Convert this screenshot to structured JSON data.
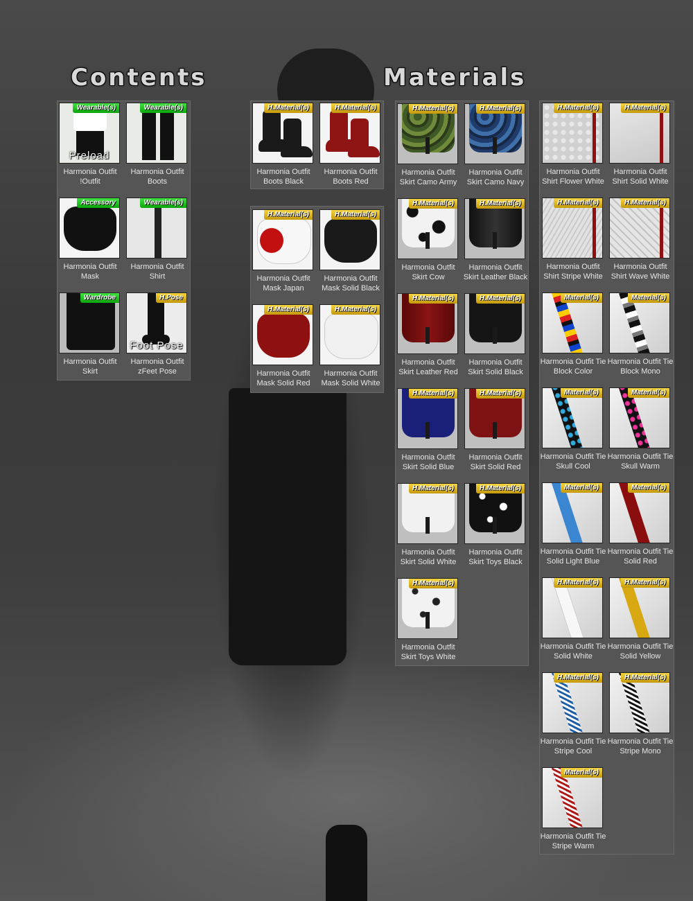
{
  "headings": {
    "contents": "Contents",
    "materials": "Materials"
  },
  "contents_tiles": [
    {
      "line1": "Harmonia Outfit",
      "line2": "!Outfit",
      "badge": "Wearable(s)",
      "badge_color": "green",
      "overlay": "Preload"
    },
    {
      "line1": "Harmonia Outfit",
      "line2": "Boots",
      "badge": "Wearable(s)",
      "badge_color": "green"
    },
    {
      "line1": "Harmonia Outfit",
      "line2": "Mask",
      "badge": "Accessory",
      "badge_color": "green"
    },
    {
      "line1": "Harmonia Outfit",
      "line2": "Shirt",
      "badge": "Wearable(s)",
      "badge_color": "green"
    },
    {
      "line1": "Harmonia Outfit",
      "line2": "Skirt",
      "badge": "Wardrobe",
      "badge_color": "green"
    },
    {
      "line1": "Harmonia Outfit",
      "line2": "zFeet Pose",
      "badge": "H.Pose",
      "badge_color": "gold",
      "overlay": "Foot Pose"
    }
  ],
  "boots_tiles": [
    {
      "line1": "Harmonia Outfit",
      "line2": "Boots Black",
      "badge": "H.Material(s)"
    },
    {
      "line1": "Harmonia Outfit",
      "line2": "Boots Red",
      "badge": "H.Material(s)"
    }
  ],
  "mask_tiles": [
    {
      "line1": "Harmonia Outfit",
      "line2": "Mask Japan",
      "badge": "H.Material(s)"
    },
    {
      "line1": "Harmonia Outfit",
      "line2": "Mask Solid Black",
      "badge": "H.Material(s)"
    },
    {
      "line1": "Harmonia Outfit",
      "line2": "Mask Solid Red",
      "badge": "H.Material(s)"
    },
    {
      "line1": "Harmonia Outfit",
      "line2": "Mask Solid White",
      "badge": "H.Material(s)"
    }
  ],
  "skirt_tiles": [
    {
      "line1": "Harmonia Outfit",
      "line2": "Skirt Camo Army",
      "badge": "H.Material(s)"
    },
    {
      "line1": "Harmonia Outfit",
      "line2": "Skirt Camo Navy",
      "badge": "H.Material(s)"
    },
    {
      "line1": "Harmonia Outfit",
      "line2": "Skirt Cow",
      "badge": "H.Material(s)"
    },
    {
      "line1": "Harmonia Outfit",
      "line2": "Skirt Leather Black",
      "badge": "H.Material(s)"
    },
    {
      "line1": "Harmonia Outfit",
      "line2": "Skirt Leather Red",
      "badge": "H.Material(s)"
    },
    {
      "line1": "Harmonia Outfit",
      "line2": "Skirt Solid Black",
      "badge": "H.Material(s)"
    },
    {
      "line1": "Harmonia Outfit",
      "line2": "Skirt Solid Blue",
      "badge": "H.Material(s)"
    },
    {
      "line1": "Harmonia Outfit",
      "line2": "Skirt Solid Red",
      "badge": "H.Material(s)"
    },
    {
      "line1": "Harmonia Outfit",
      "line2": "Skirt Solid White",
      "badge": "H.Material(s)"
    },
    {
      "line1": "Harmonia Outfit",
      "line2": "Skirt Toys Black",
      "badge": "H.Material(s)"
    },
    {
      "line1": "Harmonia Outfit",
      "line2": "Skirt Toys White",
      "badge": "H.Material(s)"
    }
  ],
  "shirt_tiles": [
    {
      "line1": "Harmonia Outfit",
      "line2": "Shirt Flower White",
      "badge": "H.Material(s)"
    },
    {
      "line1": "Harmonia Outfit",
      "line2": "Shirt Solid White",
      "badge": "H.Material(s)"
    },
    {
      "line1": "Harmonia Outfit",
      "line2": "Shirt Stripe White",
      "badge": "H.Material(s)"
    },
    {
      "line1": "Harmonia Outfit",
      "line2": "Shirt Wave White",
      "badge": "H.Material(s)"
    },
    {
      "line1": "Harmonia Outfit Tie",
      "line2": "Block Color",
      "badge": "Material(s)"
    },
    {
      "line1": "Harmonia Outfit Tie",
      "line2": "Block Mono",
      "badge": "Material(s)"
    },
    {
      "line1": "Harmonia Outfit Tie",
      "line2": "Skull Cool",
      "badge": "Material(s)"
    },
    {
      "line1": "Harmonia Outfit Tie",
      "line2": "Skull Warm",
      "badge": "Material(s)"
    },
    {
      "line1": "Harmonia Outfit Tie",
      "line2": "Solid Light Blue",
      "badge": "Material(s)"
    },
    {
      "line1": "Harmonia Outfit Tie",
      "line2": "Solid Red",
      "badge": "Material(s)"
    },
    {
      "line1": "Harmonia Outfit Tie",
      "line2": "Solid White",
      "badge": "H.Material(s)"
    },
    {
      "line1": "Harmonia Outfit Tie",
      "line2": "Solid Yellow",
      "badge": "H.Material(s)"
    },
    {
      "line1": "Harmonia Outfit Tie",
      "line2": "Stripe Cool",
      "badge": "H.Material(s)"
    },
    {
      "line1": "Harmonia Outfit Tie",
      "line2": "Stripe Mono",
      "badge": "H.Material(s)"
    },
    {
      "line1": "Harmonia Outfit Tie",
      "line2": "Stripe Warm",
      "badge": "Material(s)"
    }
  ]
}
